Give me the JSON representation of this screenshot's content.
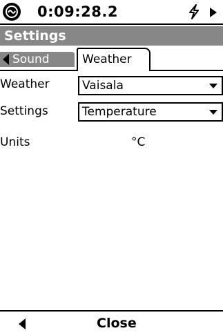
{
  "status": {
    "time": "0:09:28.2",
    "icons": [
      "instrument-icon",
      "power-icon",
      "play-icon"
    ]
  },
  "title": "Settings",
  "tabs": {
    "previous": "Sound",
    "active": "Weather"
  },
  "form": {
    "weather": {
      "label": "Weather",
      "value": "Vaisala"
    },
    "settings": {
      "label": "Settings",
      "value": "Temperature"
    },
    "units": {
      "label": "Units",
      "value": "°C"
    }
  },
  "footer": {
    "close_label": "Close"
  }
}
